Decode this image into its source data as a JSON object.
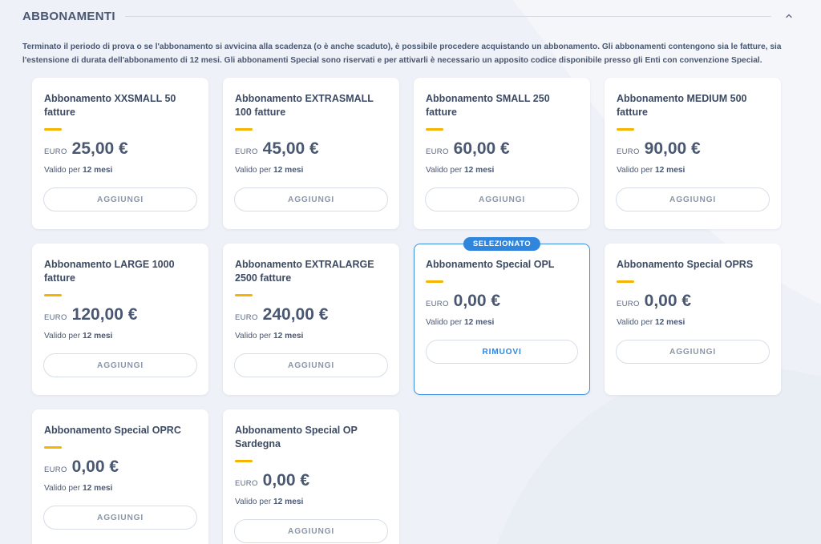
{
  "section": {
    "title": "ABBONAMENTI",
    "description": "Terminato il periodo di prova o se l'abbonamento si avvicina alla scadenza (o è anche scaduto), è possibile procedere acquistando un abbonamento. Gli abbonamenti contengono sia le fatture, sia l'estensione di durata dell'abbonamento di 12 mesi. Gli abbonamenti Special sono riservati e per attivarli è necessario un apposito codice disponibile presso gli Enti con convenzione Special."
  },
  "labels": {
    "currency": "EURO",
    "valid_prefix": "Valido per",
    "add": "AGGIUNGI",
    "remove": "RIMUOVI",
    "selected_badge": "SELEZIONATO"
  },
  "colors": {
    "accent": "#f5b400",
    "selected": "#2f86dc",
    "background": "#eef1f7"
  },
  "plans": [
    {
      "title": "Abbonamento XXSMALL 50 fatture",
      "price": "25,00 €",
      "duration": "12 mesi",
      "selected": false
    },
    {
      "title": "Abbonamento EXTRASMALL 100 fatture",
      "price": "45,00 €",
      "duration": "12 mesi",
      "selected": false
    },
    {
      "title": "Abbonamento SMALL 250 fatture",
      "price": "60,00 €",
      "duration": "12 mesi",
      "selected": false
    },
    {
      "title": "Abbonamento MEDIUM 500 fatture",
      "price": "90,00 €",
      "duration": "12 mesi",
      "selected": false
    },
    {
      "title": "Abbonamento LARGE 1000 fatture",
      "price": "120,00 €",
      "duration": "12 mesi",
      "selected": false
    },
    {
      "title": "Abbonamento EXTRALARGE 2500 fatture",
      "price": "240,00 €",
      "duration": "12 mesi",
      "selected": false
    },
    {
      "title": "Abbonamento Special OPL",
      "price": "0,00 €",
      "duration": "12 mesi",
      "selected": true
    },
    {
      "title": "Abbonamento Special OPRS",
      "price": "0,00 €",
      "duration": "12 mesi",
      "selected": false
    },
    {
      "title": "Abbonamento Special OPRC",
      "price": "0,00 €",
      "duration": "12 mesi",
      "selected": false
    },
    {
      "title": "Abbonamento Special OP Sardegna",
      "price": "0,00 €",
      "duration": "12 mesi",
      "selected": false
    }
  ]
}
